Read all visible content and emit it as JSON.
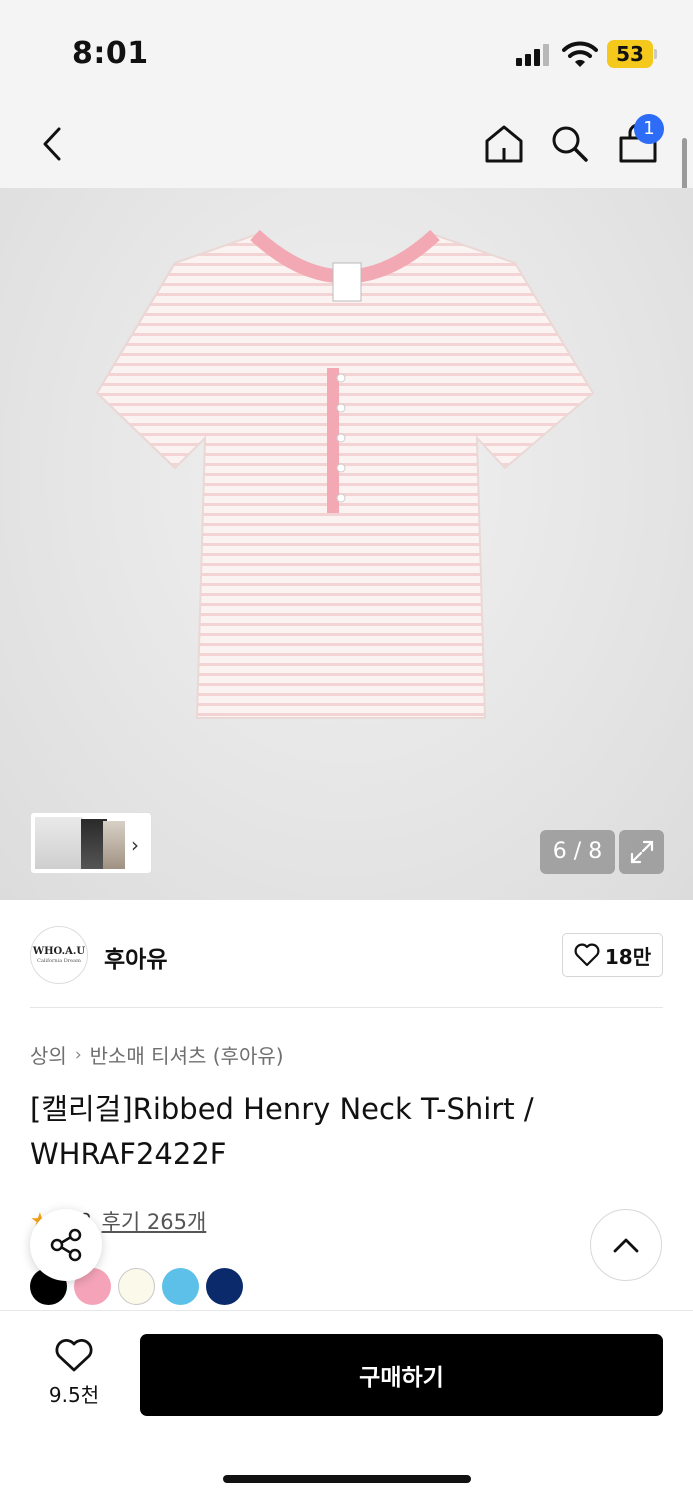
{
  "status_bar": {
    "time": "8:01",
    "battery": "53"
  },
  "nav": {
    "bag_badge": "1",
    "icons": [
      "back-icon",
      "home-icon",
      "search-icon",
      "shopping-bag-icon"
    ]
  },
  "gallery": {
    "counter": "6 / 8"
  },
  "brand": {
    "logo_text": "WHO.A.U",
    "logo_sub": "California Dream",
    "name": "후아유",
    "likes": "18만"
  },
  "breadcrumb": {
    "category": "상의",
    "subcategory": "반소매 티셔츠 (후아유)"
  },
  "product": {
    "title": "[캘리걸]Ribbed Henry Neck T-Shirt / WHRAF2422F",
    "rating": "4.8",
    "reviews": "후기 265개"
  },
  "colors": {
    "swatches": [
      "#000000",
      "#f4a3b8",
      "#fbf9ea",
      "#5cc0e8",
      "#0a2a6b"
    ],
    "brand_accent": "#2c6cf6"
  },
  "bottom": {
    "wish_count": "9.5천",
    "buy_label": "구매하기"
  }
}
